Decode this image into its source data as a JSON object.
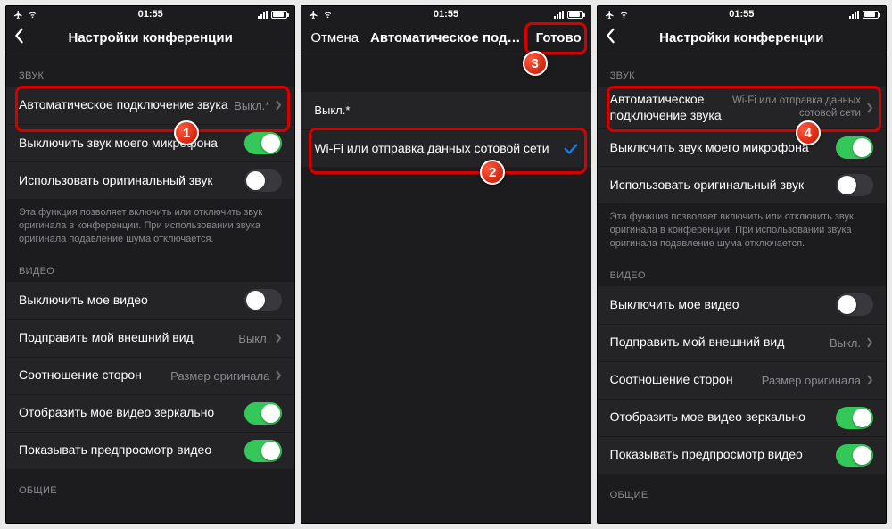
{
  "status": {
    "time": "01:55"
  },
  "panel1": {
    "nav_title": "Настройки конференции",
    "section_sound": "ЗВУК",
    "auto_connect_label": "Автоматическое подключение звука",
    "auto_connect_value": "Выкл.*",
    "mute_mic_label": "Выключить звук моего микрофона",
    "orig_sound_label": "Использовать оригинальный звук",
    "orig_sound_note": "Эта функция позволяет включить или отключить звук оригинала в конференции. При использовании звука оригинала подавление шума отключается.",
    "section_video": "ВИДЕО",
    "video_off_label": "Выключить мое видео",
    "touchup_label": "Подправить мой внешний вид",
    "touchup_value": "Выкл.",
    "aspect_label": "Соотношение сторон",
    "aspect_value": "Размер оригинала",
    "mirror_label": "Отобразить мое видео зеркально",
    "preview_label": "Показывать предпросмотр видео",
    "section_general": "ОБЩИЕ"
  },
  "panel2": {
    "cancel": "Отмена",
    "title": "Автоматическое подкл...",
    "done": "Готово",
    "opt_off": "Выкл.*",
    "opt_wifi": "Wi-Fi или отправка данных сотовой сети"
  },
  "panel3": {
    "nav_title": "Настройки конференции",
    "auto_connect_value": "Wi-Fi или отправка данных сотовой сети"
  },
  "badges": {
    "b1": "1",
    "b2": "2",
    "b3": "3",
    "b4": "4"
  }
}
